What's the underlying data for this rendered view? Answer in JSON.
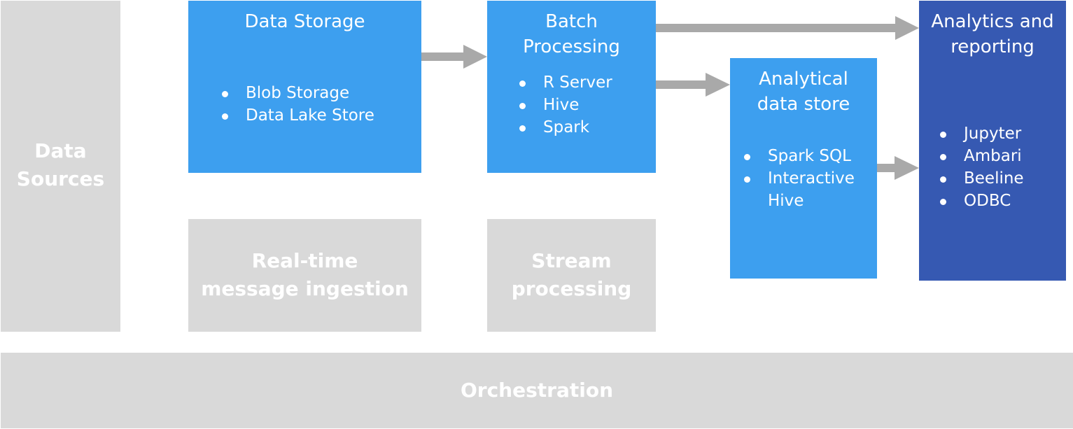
{
  "colors": {
    "inactive": "#d9d9d9",
    "active": "#3d9fef",
    "output": "#3659b2",
    "arrow": "#a9a9a9",
    "text": "#ffffff"
  },
  "nodes": {
    "data_sources": {
      "title_line1": "Data",
      "title_line2": "Sources"
    },
    "data_storage": {
      "title": "Data Storage",
      "items": [
        "Blob Storage",
        "Data Lake Store"
      ]
    },
    "batch_processing": {
      "title_line1": "Batch",
      "title_line2": "Processing",
      "items": [
        "R Server",
        "Hive",
        "Spark"
      ]
    },
    "analytical_data_store": {
      "title_line1": "Analytical",
      "title_line2": "data store",
      "items": [
        "Spark SQL",
        "Interactive",
        "Hive"
      ]
    },
    "analytics_reporting": {
      "title_line1": "Analytics and",
      "title_line2": "reporting",
      "items": [
        "Jupyter",
        "Ambari",
        "Beeline",
        "ODBC"
      ]
    },
    "realtime_ingestion": {
      "title_line1": "Real-time",
      "title_line2": "message ingestion"
    },
    "stream_processing": {
      "title_line1": "Stream",
      "title_line2": "processing"
    },
    "orchestration": {
      "title": "Orchestration"
    }
  },
  "edges": [
    {
      "from": "data_storage",
      "to": "batch_processing"
    },
    {
      "from": "batch_processing",
      "to": "analytics_reporting"
    },
    {
      "from": "batch_processing",
      "to": "analytical_data_store"
    },
    {
      "from": "analytical_data_store",
      "to": "analytics_reporting"
    }
  ]
}
